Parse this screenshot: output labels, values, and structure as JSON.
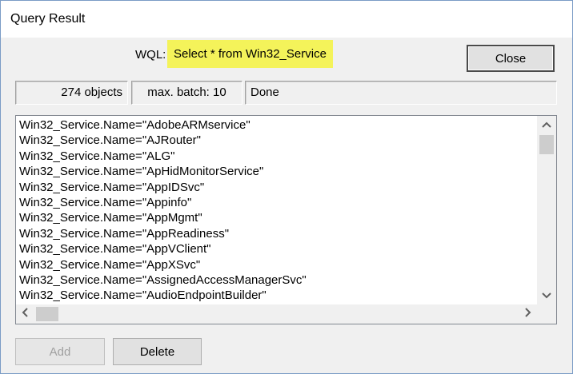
{
  "window": {
    "title": "Query Result"
  },
  "query": {
    "label": "WQL:",
    "text": "Select * from Win32_Service"
  },
  "buttons": {
    "close": "Close",
    "add": "Add",
    "delete": "Delete"
  },
  "status": {
    "count": "274 objects",
    "batch": "max. batch: 10",
    "state": "Done"
  },
  "results": [
    "Win32_Service.Name=\"AdobeARMservice\"",
    "Win32_Service.Name=\"AJRouter\"",
    "Win32_Service.Name=\"ALG\"",
    "Win32_Service.Name=\"ApHidMonitorService\"",
    "Win32_Service.Name=\"AppIDSvc\"",
    "Win32_Service.Name=\"Appinfo\"",
    "Win32_Service.Name=\"AppMgmt\"",
    "Win32_Service.Name=\"AppReadiness\"",
    "Win32_Service.Name=\"AppVClient\"",
    "Win32_Service.Name=\"AppXSvc\"",
    "Win32_Service.Name=\"AssignedAccessManagerSvc\"",
    "Win32_Service.Name=\"AudioEndpointBuilder\""
  ],
  "scrollbars": {
    "up_icon": "chevron-up-icon",
    "down_icon": "chevron-down-icon",
    "left_icon": "chevron-left-icon",
    "right_icon": "chevron-right-icon"
  },
  "colors": {
    "highlight": "#f4f35a",
    "dialog_bg": "#f0f0f0"
  }
}
